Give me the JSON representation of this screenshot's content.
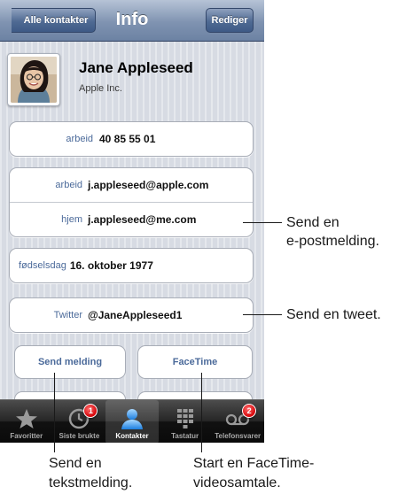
{
  "navbar": {
    "back_label": "Alle kontakter",
    "title": "Info",
    "edit_label": "Rediger"
  },
  "contact": {
    "name": "Jane Appleseed",
    "company": "Apple Inc."
  },
  "phone": {
    "label": "arbeid",
    "value": "40 85 55 01"
  },
  "emails": [
    {
      "label": "arbeid",
      "value": "j.appleseed@apple.com"
    },
    {
      "label": "hjem",
      "value": "j.appleseed@me.com"
    }
  ],
  "birthday": {
    "label": "fødselsdag",
    "value": "16. oktober 1977"
  },
  "twitter": {
    "label": "Twitter",
    "value": "@JaneAppleseed1"
  },
  "actions": {
    "send_message": "Send melding",
    "facetime": "FaceTime"
  },
  "tabbar": {
    "tabs": [
      {
        "label": "Favoritter",
        "icon": "star-icon"
      },
      {
        "label": "Siste brukte",
        "icon": "clock-icon",
        "badge": "1"
      },
      {
        "label": "Kontakter",
        "icon": "person-icon",
        "active": true
      },
      {
        "label": "Tastatur",
        "icon": "keypad-icon"
      },
      {
        "label": "Telefonsvarer",
        "icon": "voicemail-icon",
        "badge": "2"
      }
    ]
  },
  "callouts": {
    "email_line1": "Send en",
    "email_line2": "e-postmelding.",
    "tweet": "Send en tweet.",
    "message_line1": "Send en",
    "message_line2": "tekstmelding.",
    "facetime_line1": "Start en FaceTime-",
    "facetime_line2": "videosamtale."
  },
  "colors": {
    "navbar": "#7f93b1",
    "label_blue": "#4b6a9a",
    "badge_red": "#d6060b"
  }
}
